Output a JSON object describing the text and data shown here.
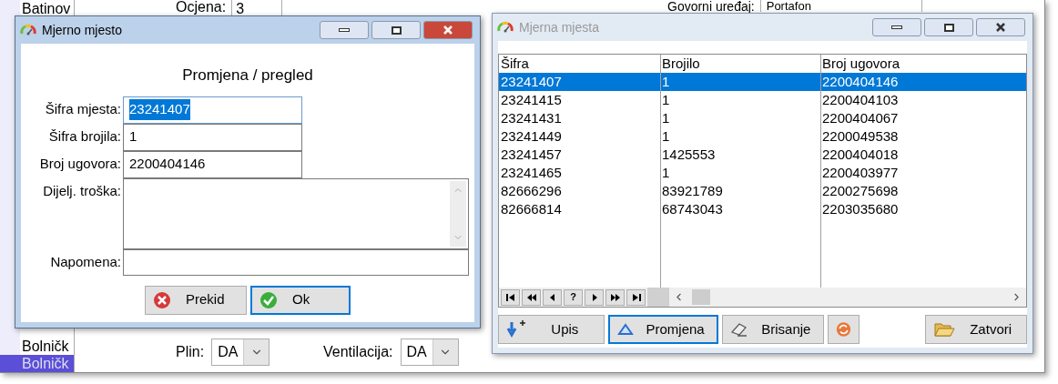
{
  "background": {
    "list_items": [
      {
        "label": "Batinov",
        "selected": false
      },
      {
        "label": "Bolničk",
        "selected": false
      },
      {
        "label": "Bolničk",
        "selected": true
      }
    ],
    "ocjena": {
      "label": "Ocjena:",
      "value": "3"
    },
    "govorni_uredjaj": {
      "label": "Govorni uređaj:",
      "value": "Portafon"
    },
    "plin": {
      "label": "Plin:",
      "value": "DA"
    },
    "ventilacija": {
      "label": "Ventilacija:",
      "value": "DA"
    }
  },
  "dialog": {
    "title": "Mjerno mjesto",
    "active": true,
    "heading": "Promjena / pregled",
    "fields": [
      {
        "kind": "text",
        "label": "Šifra mjesta:",
        "value": "23241407",
        "highlighted": true
      },
      {
        "kind": "text",
        "label": "Šifra brojila:",
        "value": "1",
        "highlighted": false
      },
      {
        "kind": "text",
        "label": "Broj ugovora:",
        "value": "2200404146",
        "highlighted": false
      },
      {
        "kind": "memo",
        "label": "Dijelj. troška:"
      },
      {
        "kind": "wide",
        "label": "Napomena:"
      }
    ],
    "buttons": [
      {
        "kind": "cancel",
        "label": "Prekid",
        "focused": false
      },
      {
        "kind": "ok",
        "label": "Ok",
        "focused": true
      }
    ]
  },
  "list_window": {
    "title": "Mjerna mjesta",
    "active": false,
    "table": {
      "columns": [
        "Šifra",
        "Brojilo",
        "Broj ugovora"
      ],
      "rows": [
        {
          "cells": [
            "23241407",
            "1",
            "2200404146"
          ],
          "selected": true
        },
        {
          "cells": [
            "23241415",
            "1",
            "2200404103"
          ],
          "selected": false
        },
        {
          "cells": [
            "23241431",
            "1",
            "2200404067"
          ],
          "selected": false
        },
        {
          "cells": [
            "23241449",
            "1",
            "2200049538"
          ],
          "selected": false
        },
        {
          "cells": [
            "23241457",
            "1425553",
            "2200404018"
          ],
          "selected": false
        },
        {
          "cells": [
            "23241465",
            "1",
            "2200403977"
          ],
          "selected": false
        },
        {
          "cells": [
            "82666296",
            "83921789",
            "2200275698"
          ],
          "selected": false
        },
        {
          "cells": [
            "82666814",
            "68743043",
            "2203035680"
          ],
          "selected": false
        }
      ]
    },
    "navigator": [
      {
        "kind": "first"
      },
      {
        "kind": "prior-page"
      },
      {
        "kind": "prior"
      },
      {
        "kind": "help",
        "label": "?"
      },
      {
        "kind": "next"
      },
      {
        "kind": "next-page"
      },
      {
        "kind": "last"
      }
    ],
    "buttons": [
      {
        "kind": "insert",
        "label": "Upis",
        "focused": false
      },
      {
        "kind": "edit",
        "label": "Promjena",
        "focused": true
      },
      {
        "kind": "delete",
        "label": "Brisanje",
        "focused": false
      },
      {
        "kind": "refresh",
        "focused": false
      },
      {
        "kind": "close",
        "label": "Zatvori",
        "focused": false
      }
    ]
  }
}
